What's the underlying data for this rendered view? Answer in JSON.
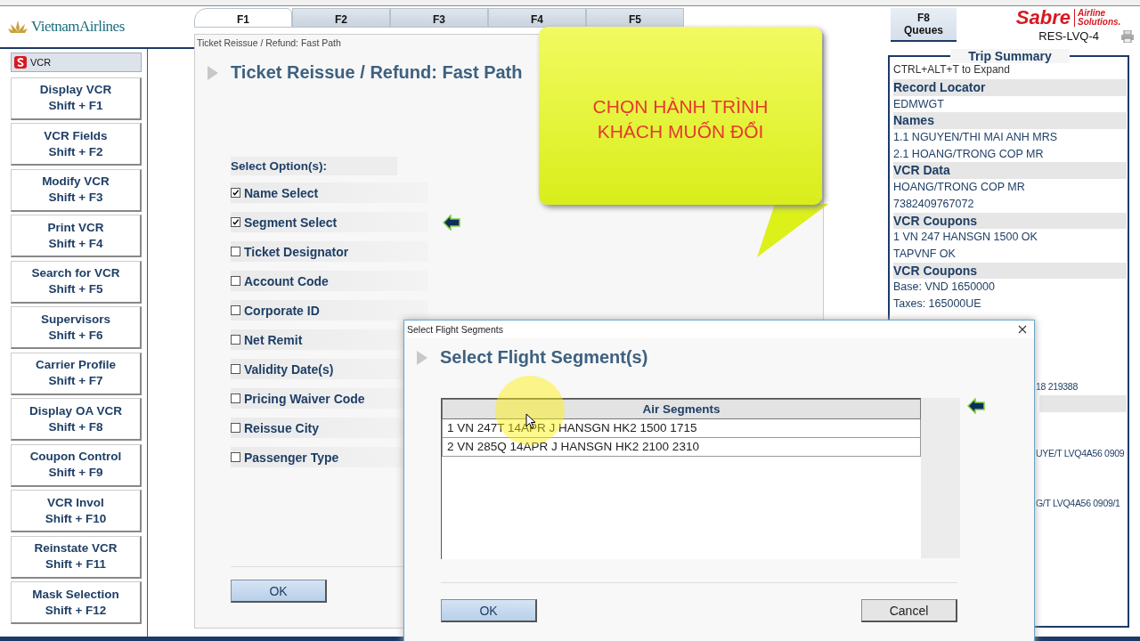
{
  "logo": {
    "text": "VietnamAirlines"
  },
  "tabs": [
    {
      "key": "F1",
      "selected": true
    },
    {
      "key": "F2",
      "selected": false
    },
    {
      "key": "F3",
      "selected": false
    },
    {
      "key": "F4",
      "selected": false
    },
    {
      "key": "F5",
      "selected": false
    }
  ],
  "queues_tab": {
    "key": "F8",
    "label": "Queues"
  },
  "brand": {
    "name": "Sabre",
    "tagline": "Airline Solutions.",
    "station": "RES-LVQ-4"
  },
  "sidebar": {
    "header": "VCR",
    "items": [
      {
        "label": "Display VCR",
        "shortcut": "Shift + F1"
      },
      {
        "label": "VCR Fields",
        "shortcut": "Shift + F2"
      },
      {
        "label": "Modify VCR",
        "shortcut": "Shift + F3"
      },
      {
        "label": "Print VCR",
        "shortcut": "Shift + F4"
      },
      {
        "label": "Search for VCR",
        "shortcut": "Shift + F5"
      },
      {
        "label": "Supervisors",
        "shortcut": "Shift + F6"
      },
      {
        "label": "Carrier Profile",
        "shortcut": "Shift + F7"
      },
      {
        "label": "Display OA VCR",
        "shortcut": "Shift + F8"
      },
      {
        "label": "Coupon Control",
        "shortcut": "Shift + F9"
      },
      {
        "label": "VCR Invol",
        "shortcut": "Shift + F10"
      },
      {
        "label": "Reinstate VCR",
        "shortcut": "Shift + F11"
      },
      {
        "label": "Mask Selection",
        "shortcut": "Shift + F12"
      }
    ]
  },
  "window": {
    "title": "Ticket Reissue / Refund: Fast Path",
    "heading": "Ticket Reissue / Refund: Fast Path",
    "options_label": "Select Option(s):",
    "options": [
      {
        "label": "Name Select",
        "checked": true
      },
      {
        "label": "Segment Select",
        "checked": true
      },
      {
        "label": "Ticket Designator",
        "checked": false
      },
      {
        "label": "Account Code",
        "checked": false
      },
      {
        "label": "Corporate ID",
        "checked": false
      },
      {
        "label": "Net Remit",
        "checked": false
      },
      {
        "label": "Validity Date(s)",
        "checked": false
      },
      {
        "label": "Pricing Waiver Code",
        "checked": false
      },
      {
        "label": "Reissue City",
        "checked": false
      },
      {
        "label": "Passenger Type",
        "checked": false
      }
    ],
    "ok_button": "OK"
  },
  "callout": {
    "text": "CHỌN HÀNH TRÌNH KHÁCH MUỐN ĐỔI"
  },
  "trip_summary": {
    "title": "Trip Summary",
    "hint": "CTRL+ALT+T to Expand",
    "lines": [
      {
        "kind": "heading",
        "text": "Record Locator"
      },
      {
        "kind": "value",
        "text": "EDMWGT"
      },
      {
        "kind": "heading",
        "text": "Names"
      },
      {
        "kind": "value",
        "text": "1.1 NGUYEN/THI MAI ANH MRS"
      },
      {
        "kind": "value",
        "text": "2.1 HOANG/TRONG COP MR"
      },
      {
        "kind": "heading",
        "text": "VCR Data"
      },
      {
        "kind": "value",
        "text": "HOANG/TRONG COP MR"
      },
      {
        "kind": "value",
        "text": "7382409767072"
      },
      {
        "kind": "heading",
        "text": "VCR Coupons"
      },
      {
        "kind": "value",
        "text": "1 VN 247  HANSGN 1500 OK"
      },
      {
        "kind": "value",
        "text": "TAPVNF OK"
      },
      {
        "kind": "heading",
        "text": "VCR Coupons"
      },
      {
        "kind": "value",
        "text": "Base: VND  1650000"
      },
      {
        "kind": "value",
        "text": "Taxes:  165000UE"
      },
      {
        "kind": "gap"
      },
      {
        "kind": "gap"
      },
      {
        "kind": "gap"
      },
      {
        "kind": "gap"
      },
      {
        "kind": "fragment",
        "text": "18 219388"
      },
      {
        "kind": "band"
      },
      {
        "kind": "gap"
      },
      {
        "kind": "gap"
      },
      {
        "kind": "fragment",
        "text": "UYE/T LVQ4A56 0909"
      },
      {
        "kind": "gap"
      },
      {
        "kind": "gap"
      },
      {
        "kind": "fragment",
        "text": "G/T LVQ4A56 0909/1"
      }
    ]
  },
  "dialog": {
    "title": "Select Flight Segments",
    "heading": "Select Flight Segment(s)",
    "column": "Air Segments",
    "rows": [
      {
        "text": "1 VN 247T 14APR J HANSGN HK2  1500  1715",
        "selected": false
      },
      {
        "text": "2 VN 285Q 14APR J HANSGN HK2  2100  2310",
        "selected": false
      }
    ],
    "ok_button": "OK",
    "cancel_button": "Cancel"
  }
}
